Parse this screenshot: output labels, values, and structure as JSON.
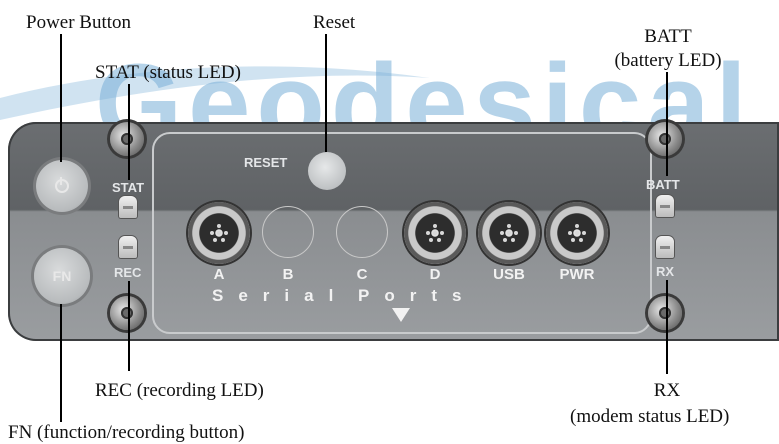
{
  "watermark": {
    "text": "Geodesical",
    "color": "#78afd7"
  },
  "callouts": {
    "power_button": "Power Button",
    "reset": "Reset",
    "batt_title": "BATT",
    "batt_desc": "(battery LED)",
    "stat": "STAT (status LED)",
    "rec": "REC (recording LED)",
    "rx_title": "RX",
    "rx_desc": "(modem status LED)",
    "fn": "FN (function/recording button)"
  },
  "panel": {
    "reset_label": "RESET",
    "stat_label": "STAT",
    "rec_label": "REC",
    "batt_label": "BATT",
    "rx_label": "RX",
    "fn_label": "FN",
    "ports": [
      "A",
      "B",
      "C",
      "D",
      "USB",
      "PWR"
    ],
    "serial_label": "Serial",
    "ports_group_label": "Ports"
  },
  "icons": {
    "power": "power-icon",
    "arrow": "arrow-down-icon"
  }
}
